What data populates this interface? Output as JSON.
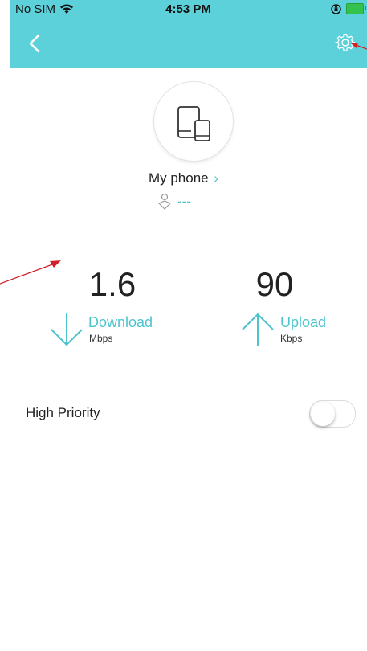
{
  "status_bar": {
    "carrier": "No SIM",
    "time": "4:53 PM"
  },
  "icons": {
    "back": "chevron-left-icon",
    "settings": "gear-icon",
    "device": "tablet-phone-icon",
    "ip": "location-pin-icon",
    "download": "arrow-down-icon",
    "upload": "arrow-up-icon"
  },
  "device": {
    "name": "My phone",
    "ip_address": "---"
  },
  "speeds": {
    "download": {
      "value": "1.6",
      "label": "Download",
      "unit": "Mbps"
    },
    "upload": {
      "value": "90",
      "label": "Upload",
      "unit": "Kbps"
    }
  },
  "priority": {
    "label": "High Priority",
    "enabled": false
  },
  "colors": {
    "header": "#5cd1d9",
    "accent": "#4cc4cc",
    "annotation": "#d0202a"
  }
}
